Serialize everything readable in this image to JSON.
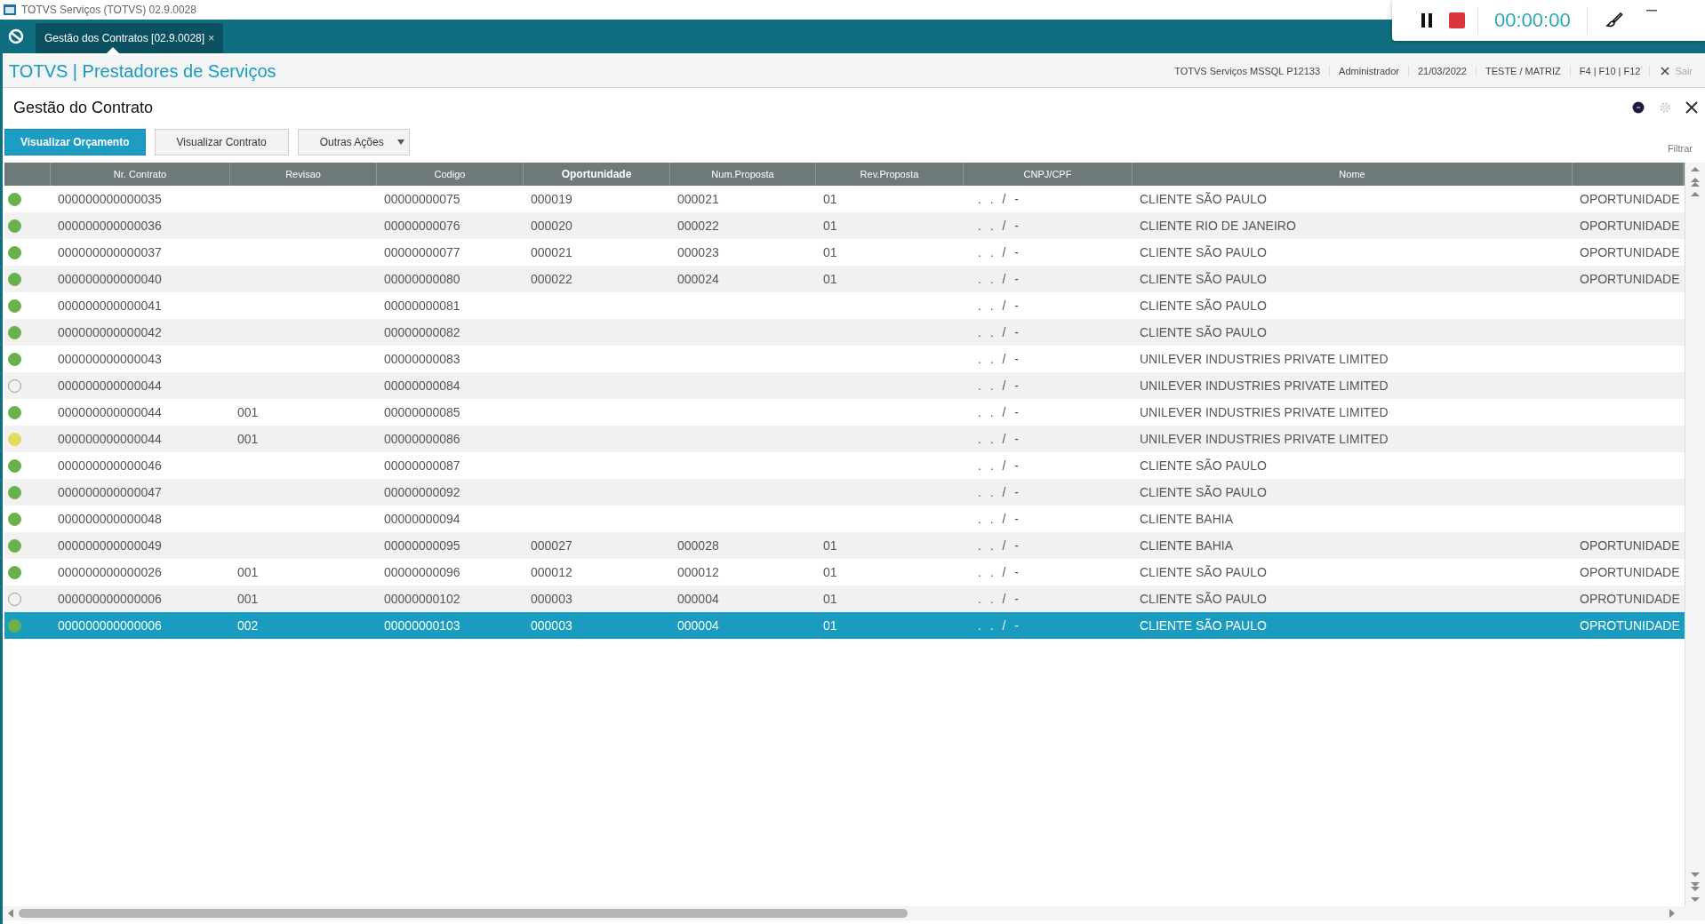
{
  "window": {
    "title": "TOTVS Serviços (TOTVS) 02.9.0028"
  },
  "tabs": [
    {
      "label": "Gestão dos Contratos [02.9.0028]",
      "close": "×",
      "selected": true
    }
  ],
  "recorder": {
    "timer": "00:00:00"
  },
  "header": {
    "app_title": "TOTVS | Prestadores de Serviços",
    "info": [
      "TOTVS Serviços MSSQL P12133",
      "Administrador",
      "21/03/2022",
      "TESTE / MATRIZ",
      "F4 | F10 | F12"
    ],
    "exit": "Sair"
  },
  "page": {
    "title": "Gestão do Contrato",
    "filter": "Filtrar"
  },
  "buttons": [
    {
      "label": "Visualizar Orçamento",
      "kind": "primary"
    },
    {
      "label": "Visualizar Contrato",
      "kind": "plain"
    },
    {
      "label": "Outras Ações",
      "kind": "dropdown"
    }
  ],
  "table": {
    "columns": [
      {
        "label": "Nr. Contrato",
        "sorted": false
      },
      {
        "label": "Revisao",
        "sorted": false
      },
      {
        "label": "Codigo",
        "sorted": false
      },
      {
        "label": "Oportunidade",
        "sorted": true
      },
      {
        "label": "Num.Proposta",
        "sorted": false
      },
      {
        "label": "Rev.Proposta",
        "sorted": false
      },
      {
        "label": "CNPJ/CPF",
        "sorted": false
      },
      {
        "label": "Nome",
        "sorted": false
      }
    ],
    "rows": [
      {
        "color": "#6ab04c",
        "selected": false,
        "cells": [
          "000000000000035",
          "",
          "00000000075",
          "000019",
          "000021",
          "01",
          ". . / -",
          "CLIENTE SÃO PAULO",
          "OPORTUNIDADE"
        ]
      },
      {
        "color": "#6ab04c",
        "selected": false,
        "cells": [
          "000000000000036",
          "",
          "00000000076",
          "000020",
          "000022",
          "01",
          ". . / -",
          "CLIENTE RIO DE JANEIRO",
          "OPORTUNIDADE"
        ]
      },
      {
        "color": "#6ab04c",
        "selected": false,
        "cells": [
          "000000000000037",
          "",
          "00000000077",
          "000021",
          "000023",
          "01",
          ". . / -",
          "CLIENTE SÃO PAULO",
          "OPORTUNIDADE"
        ]
      },
      {
        "color": "#6ab04c",
        "selected": false,
        "cells": [
          "000000000000040",
          "",
          "00000000080",
          "000022",
          "000024",
          "01",
          ". . / -",
          "CLIENTE SÃO PAULO",
          "OPORTUNIDADE"
        ]
      },
      {
        "color": "#6ab04c",
        "selected": false,
        "cells": [
          "000000000000041",
          "",
          "00000000081",
          "",
          "",
          "",
          ". . / -",
          "CLIENTE SÃO PAULO",
          ""
        ]
      },
      {
        "color": "#6ab04c",
        "selected": false,
        "cells": [
          "000000000000042",
          "",
          "00000000082",
          "",
          "",
          "",
          ". . / -",
          "CLIENTE SÃO PAULO",
          ""
        ]
      },
      {
        "color": "#6ab04c",
        "selected": false,
        "cells": [
          "000000000000043",
          "",
          "00000000083",
          "",
          "",
          "",
          ". . / -",
          "UNILEVER INDUSTRIES PRIVATE LIMITED",
          ""
        ]
      },
      {
        "color": "#f2f2f2",
        "selected": false,
        "cells": [
          "000000000000044",
          "",
          "00000000084",
          "",
          "",
          "",
          ". . / -",
          "UNILEVER INDUSTRIES PRIVATE LIMITED",
          ""
        ]
      },
      {
        "color": "#6ab04c",
        "selected": false,
        "cells": [
          "000000000000044",
          "001",
          "00000000085",
          "",
          "",
          "",
          ". . / -",
          "UNILEVER INDUSTRIES PRIVATE LIMITED",
          ""
        ]
      },
      {
        "color": "#e3dc5a",
        "selected": false,
        "cells": [
          "000000000000044",
          "001",
          "00000000086",
          "",
          "",
          "",
          ". . / -",
          "UNILEVER INDUSTRIES PRIVATE LIMITED",
          ""
        ]
      },
      {
        "color": "#6ab04c",
        "selected": false,
        "cells": [
          "000000000000046",
          "",
          "00000000087",
          "",
          "",
          "",
          ". . / -",
          "CLIENTE SÃO PAULO",
          ""
        ]
      },
      {
        "color": "#6ab04c",
        "selected": false,
        "cells": [
          "000000000000047",
          "",
          "00000000092",
          "",
          "",
          "",
          ". . / -",
          "CLIENTE SÃO PAULO",
          ""
        ]
      },
      {
        "color": "#6ab04c",
        "selected": false,
        "cells": [
          "000000000000048",
          "",
          "00000000094",
          "",
          "",
          "",
          ". . / -",
          "CLIENTE BAHIA",
          ""
        ]
      },
      {
        "color": "#6ab04c",
        "selected": false,
        "cells": [
          "000000000000049",
          "",
          "00000000095",
          "000027",
          "000028",
          "01",
          ". . / -",
          "CLIENTE BAHIA",
          "OPORTUNIDADE"
        ]
      },
      {
        "color": "#6ab04c",
        "selected": false,
        "cells": [
          "000000000000026",
          "001",
          "00000000096",
          "000012",
          "000012",
          "01",
          ". . / -",
          "CLIENTE SÃO PAULO",
          "OPORTUNIDADE"
        ]
      },
      {
        "color": "#f2f2f2",
        "selected": false,
        "cells": [
          "000000000000006",
          "001",
          "00000000102",
          "000003",
          "000004",
          "01",
          ". . / -",
          "CLIENTE SÃO PAULO",
          "OPROTUNIDADE"
        ]
      },
      {
        "color": "#6ab04c",
        "selected": true,
        "cells": [
          "000000000000006",
          "002",
          "00000000103",
          "000003",
          "000004",
          "01",
          ". . / -",
          "CLIENTE SÃO PAULO",
          "OPROTUNIDADE"
        ]
      }
    ]
  }
}
